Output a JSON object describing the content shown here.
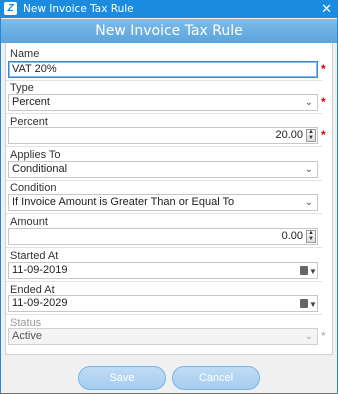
{
  "window": {
    "title": "New Invoice Tax Rule",
    "close_glyph": "✕",
    "app_icon": "Z"
  },
  "header": {
    "title": "New Invoice Tax Rule"
  },
  "form": {
    "name": {
      "label": "Name",
      "value": "VAT 20%"
    },
    "type": {
      "label": "Type",
      "value": "Percent"
    },
    "percent": {
      "label": "Percent",
      "value": "20.00"
    },
    "applies_to": {
      "label": "Applies To",
      "value": "Conditional"
    },
    "condition": {
      "label": "Condition",
      "value": "If Invoice Amount is Greater Than or Equal To"
    },
    "amount": {
      "label": "Amount",
      "value": "0.00"
    },
    "started_at": {
      "label": "Started At",
      "value": "11-09-2019"
    },
    "ended_at": {
      "label": "Ended At",
      "value": "11-09-2029"
    },
    "status": {
      "label": "Status",
      "value": "Active"
    },
    "required_marker": "*"
  },
  "buttons": {
    "save": "Save",
    "cancel": "Cancel"
  },
  "colors": {
    "accent": "#1b8be0",
    "header": "#6aaee3",
    "required": "#dd0000",
    "button": "#a6cdf0"
  },
  "icons": {
    "dropdown": "chevron-down-icon",
    "spinner": "spinner-icon",
    "calendar": "calendar-icon"
  }
}
